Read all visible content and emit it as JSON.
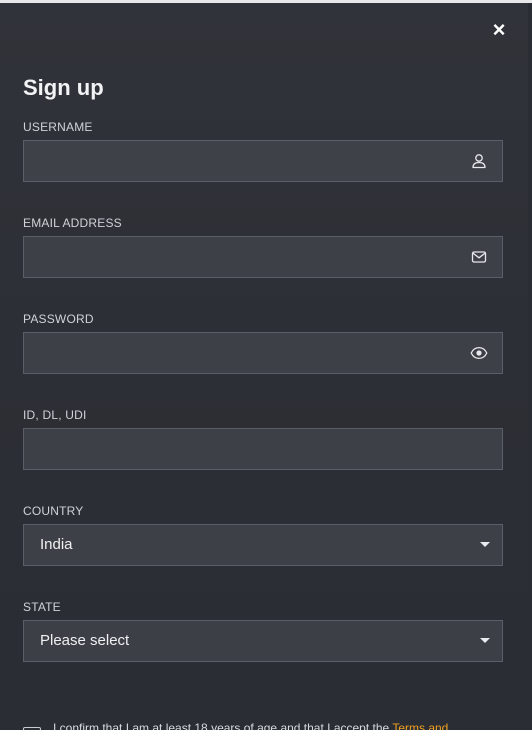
{
  "dialog": {
    "title": "Sign up",
    "close_label": "×"
  },
  "fields": {
    "username": {
      "label": "USERNAME",
      "value": "",
      "icon": "user-icon"
    },
    "email": {
      "label": "EMAIL ADDRESS",
      "value": "",
      "icon": "mail-icon"
    },
    "password": {
      "label": "PASSWORD",
      "value": "",
      "icon": "eye-icon"
    },
    "id": {
      "label": "ID, DL, UDI",
      "value": ""
    },
    "country": {
      "label": "COUNTRY",
      "selected": "India"
    },
    "state": {
      "label": "STATE",
      "selected": "Please select"
    }
  },
  "confirm": {
    "text": "I confirm that I am at least 18 years of age and that I accept the ",
    "link": "Terms and"
  },
  "colors": {
    "accent": "#f0a020",
    "background": "#2d3036",
    "field_border": "#5a5e66"
  }
}
